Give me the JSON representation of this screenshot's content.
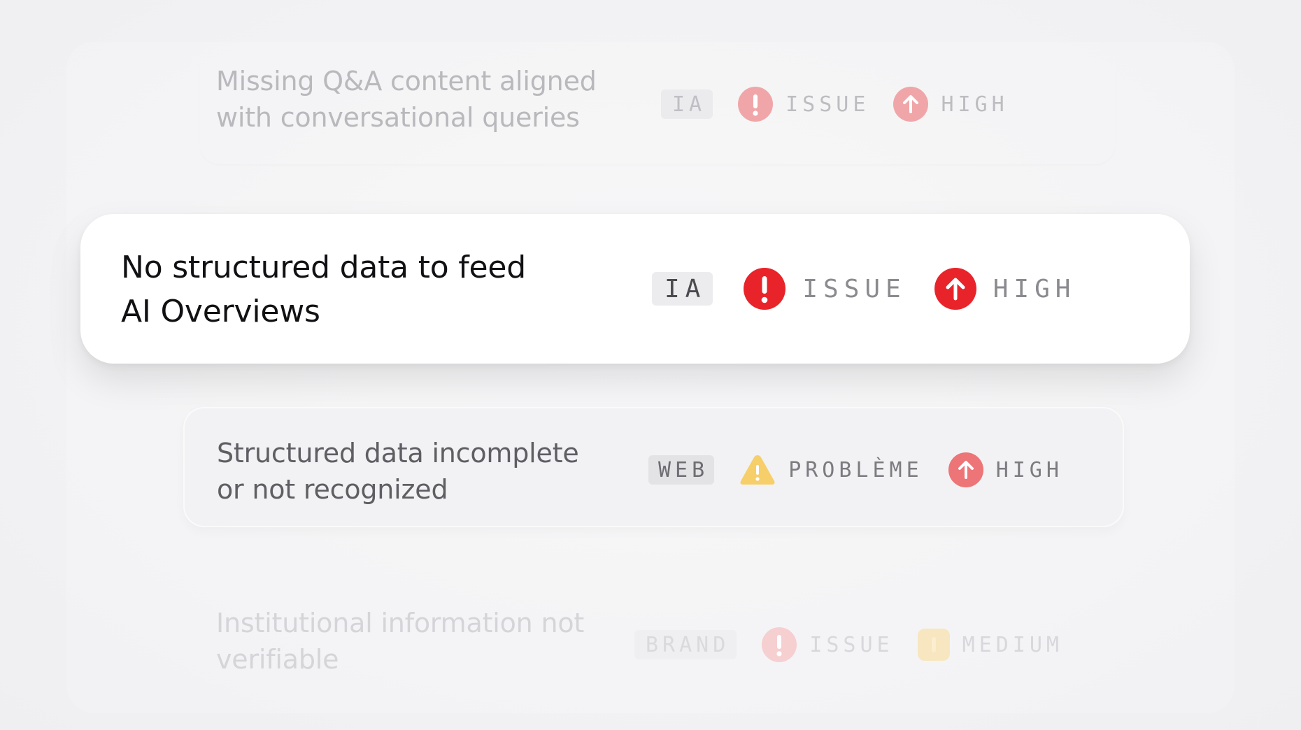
{
  "colors": {
    "issue_red": "#e8242a",
    "warning_yellow": "#f5c542",
    "card_white": "#ffffff",
    "background": "#f3f3f5"
  },
  "rows": [
    {
      "title": "Missing Q&A content aligned with conversational queries",
      "tag": "IA",
      "status": {
        "icon": "exclamation-circle-icon",
        "label": "ISSUE"
      },
      "priority": {
        "icon": "arrow-up-circle-icon",
        "label": "HIGH"
      }
    },
    {
      "title": "No structured data to feed AI Overviews",
      "tag": "IA",
      "status": {
        "icon": "exclamation-circle-icon",
        "label": "ISSUE"
      },
      "priority": {
        "icon": "arrow-up-circle-icon",
        "label": "HIGH"
      }
    },
    {
      "title": "Structured data incomplete or not recognized",
      "tag": "WEB",
      "status": {
        "icon": "warning-triangle-icon",
        "label": "PROBLÈME"
      },
      "priority": {
        "icon": "arrow-up-circle-icon",
        "label": "HIGH"
      }
    },
    {
      "title": "Institutional information not verifiable",
      "tag": "BRAND",
      "status": {
        "icon": "exclamation-circle-icon",
        "label": "ISSUE"
      },
      "priority": {
        "icon": "medium-priority-icon",
        "label": "MEDIUM"
      }
    }
  ]
}
